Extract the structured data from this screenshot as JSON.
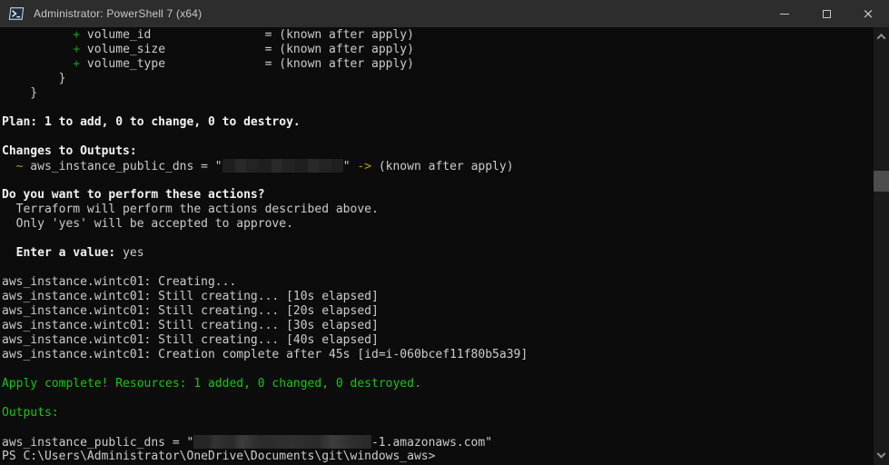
{
  "window": {
    "title": "Administrator: PowerShell 7 (x64)",
    "controls": {
      "close_glyph": "×"
    }
  },
  "icons": {
    "app": "powershell-icon",
    "minimize": "minimize-icon",
    "maximize": "maximize-icon",
    "close": "close-icon",
    "scroll_up": "chevron-up-icon",
    "scroll_down": "chevron-down-icon"
  },
  "colors": {
    "background": "#0c0c0c",
    "foreground": "#cccccc",
    "green": "#13a10e",
    "bright_green": "#16c60c",
    "yellow": "#c19c00",
    "titlebar": "#2d2d2d",
    "scrollbar_thumb": "#4d4d4d"
  },
  "terminal": {
    "lines": [
      [
        {
          "t": "          ",
          "s": "d"
        },
        {
          "t": "+",
          "s": "g"
        },
        {
          "t": " volume_id                = (known after apply)",
          "s": "d"
        }
      ],
      [
        {
          "t": "          ",
          "s": "d"
        },
        {
          "t": "+",
          "s": "g"
        },
        {
          "t": " volume_size              = (known after apply)",
          "s": "d"
        }
      ],
      [
        {
          "t": "          ",
          "s": "d"
        },
        {
          "t": "+",
          "s": "g"
        },
        {
          "t": " volume_type              = (known after apply)",
          "s": "d"
        }
      ],
      [
        {
          "t": "        }",
          "s": "d"
        }
      ],
      [
        {
          "t": "    }",
          "s": "d"
        }
      ],
      [],
      [
        {
          "t": "Plan: 1 to add, 0 to change, 0 to destroy.",
          "s": "b"
        }
      ],
      [],
      [
        {
          "t": "Changes to Outputs:",
          "s": "b"
        }
      ],
      [
        {
          "t": "  ",
          "s": "d"
        },
        {
          "t": "~",
          "s": "y"
        },
        {
          "t": " aws_instance_public_dns = \"",
          "s": "d"
        },
        {
          "r": 17,
          "variant": "dark"
        },
        {
          "t": "\" ",
          "s": "d"
        },
        {
          "t": "->",
          "s": "y"
        },
        {
          "t": " (known after apply)",
          "s": "d"
        }
      ],
      [],
      [
        {
          "t": "Do you want to perform these actions?",
          "s": "b"
        }
      ],
      [
        {
          "t": "  Terraform will perform the actions described above.",
          "s": "d"
        }
      ],
      [
        {
          "t": "  Only 'yes' will be accepted to approve.",
          "s": "d"
        }
      ],
      [],
      [
        {
          "t": "  Enter a value: ",
          "s": "b"
        },
        {
          "t": "yes",
          "s": "d"
        }
      ],
      [],
      [
        {
          "t": "aws_instance.wintc01: Creating...",
          "s": "d"
        }
      ],
      [
        {
          "t": "aws_instance.wintc01: Still creating... [10s elapsed]",
          "s": "d"
        }
      ],
      [
        {
          "t": "aws_instance.wintc01: Still creating... [20s elapsed]",
          "s": "d"
        }
      ],
      [
        {
          "t": "aws_instance.wintc01: Still creating... [30s elapsed]",
          "s": "d"
        }
      ],
      [
        {
          "t": "aws_instance.wintc01: Still creating... [40s elapsed]",
          "s": "d"
        }
      ],
      [
        {
          "t": "aws_instance.wintc01: Creation complete after 45s [id=i-060bcef11f80b5a39]",
          "s": "d"
        }
      ],
      [],
      [
        {
          "t": "Apply complete! Resources: 1 added, 0 changed, 0 destroyed.",
          "s": "gb"
        }
      ],
      [],
      [
        {
          "t": "Outputs:",
          "s": "gb"
        }
      ],
      [],
      [
        {
          "t": "aws_instance_public_dns = \"",
          "s": "d"
        },
        {
          "r": 25,
          "variant": "light"
        },
        {
          "t": "-1.amazonaws.com\"",
          "s": "d"
        }
      ],
      [
        {
          "t": "PS C:\\Users\\Administrator\\OneDrive\\Documents\\git\\windows_aws>",
          "s": "d"
        }
      ]
    ]
  }
}
